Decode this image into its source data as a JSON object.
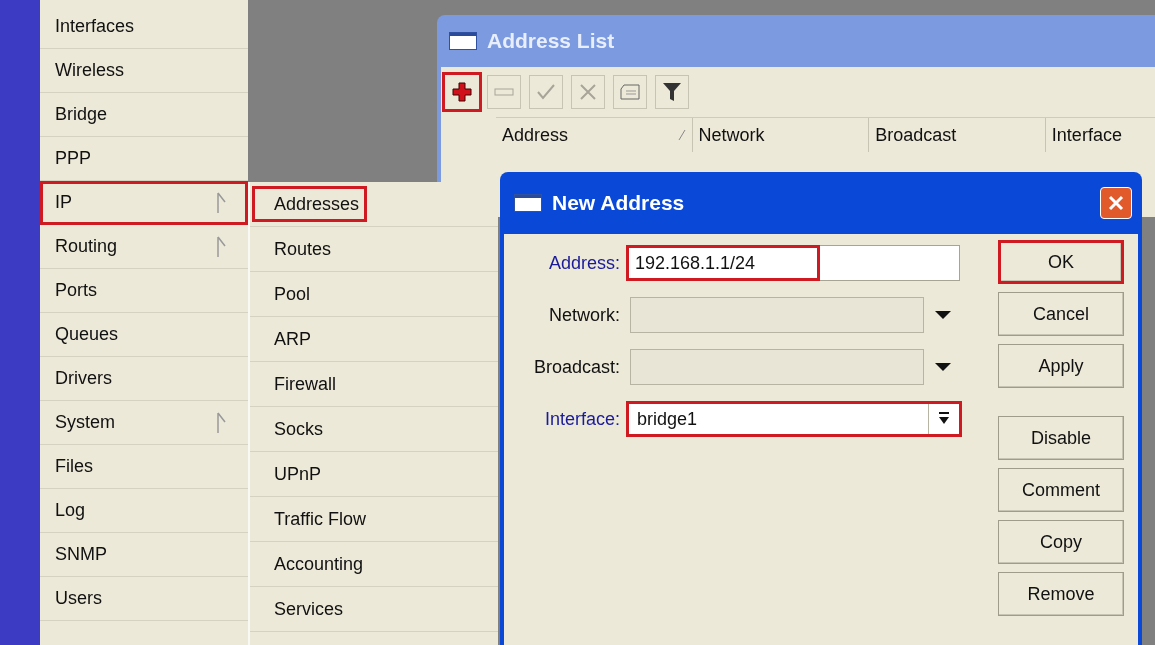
{
  "main_menu": {
    "items": [
      {
        "label": "Interfaces",
        "submenu": false,
        "highlighted": false
      },
      {
        "label": "Wireless",
        "submenu": false,
        "highlighted": false
      },
      {
        "label": "Bridge",
        "submenu": false,
        "highlighted": false
      },
      {
        "label": "PPP",
        "submenu": false,
        "highlighted": false
      },
      {
        "label": "IP",
        "submenu": true,
        "highlighted": true
      },
      {
        "label": "Routing",
        "submenu": true,
        "highlighted": false
      },
      {
        "label": "Ports",
        "submenu": false,
        "highlighted": false
      },
      {
        "label": "Queues",
        "submenu": false,
        "highlighted": false
      },
      {
        "label": "Drivers",
        "submenu": false,
        "highlighted": false
      },
      {
        "label": "System",
        "submenu": true,
        "highlighted": false
      },
      {
        "label": "Files",
        "submenu": false,
        "highlighted": false
      },
      {
        "label": "Log",
        "submenu": false,
        "highlighted": false
      },
      {
        "label": "SNMP",
        "submenu": false,
        "highlighted": false
      },
      {
        "label": "Users",
        "submenu": false,
        "highlighted": false
      }
    ]
  },
  "submenu": {
    "items": [
      {
        "label": "Addresses",
        "highlighted": true
      },
      {
        "label": "Routes",
        "highlighted": false
      },
      {
        "label": "Pool",
        "highlighted": false
      },
      {
        "label": "ARP",
        "highlighted": false
      },
      {
        "label": "Firewall",
        "highlighted": false
      },
      {
        "label": "Socks",
        "highlighted": false
      },
      {
        "label": "UPnP",
        "highlighted": false
      },
      {
        "label": "Traffic Flow",
        "highlighted": false
      },
      {
        "label": "Accounting",
        "highlighted": false
      },
      {
        "label": "Services",
        "highlighted": false
      }
    ]
  },
  "address_list": {
    "title": "Address List",
    "toolbar": [
      {
        "kind": "add",
        "disabled": false,
        "highlighted": true
      },
      {
        "kind": "remove",
        "disabled": true,
        "highlighted": false
      },
      {
        "kind": "enable",
        "disabled": true,
        "highlighted": false
      },
      {
        "kind": "disable",
        "disabled": true,
        "highlighted": false
      },
      {
        "kind": "comment",
        "disabled": false,
        "highlighted": false
      },
      {
        "kind": "filter",
        "disabled": false,
        "highlighted": false
      }
    ],
    "columns": [
      {
        "label": "Address",
        "sorted": true
      },
      {
        "label": "Network",
        "sorted": false
      },
      {
        "label": "Broadcast",
        "sorted": false
      },
      {
        "label": "Interface",
        "sorted": false
      }
    ]
  },
  "dialog": {
    "title": "New Address",
    "fields": [
      {
        "label": "Address:",
        "required": true,
        "value": "192.168.1.1/24",
        "kind": "text",
        "disabled": false,
        "highlighted": true
      },
      {
        "label": "Network:",
        "required": false,
        "kind": "dropdown",
        "disabled": true,
        "highlighted": false
      },
      {
        "label": "Broadcast:",
        "required": false,
        "kind": "dropdown",
        "disabled": true,
        "highlighted": false
      },
      {
        "label": "Interface:",
        "required": true,
        "value": "bridge1",
        "kind": "select",
        "disabled": false,
        "highlighted": true
      }
    ],
    "buttons": [
      {
        "label": "OK",
        "highlighted": true
      },
      {
        "label": "Cancel",
        "highlighted": false
      },
      {
        "label": "Apply",
        "highlighted": false
      },
      {
        "label": "Disable",
        "highlighted": false
      },
      {
        "label": "Comment",
        "highlighted": false
      },
      {
        "label": "Copy",
        "highlighted": false
      },
      {
        "label": "Remove",
        "highlighted": false
      }
    ]
  }
}
